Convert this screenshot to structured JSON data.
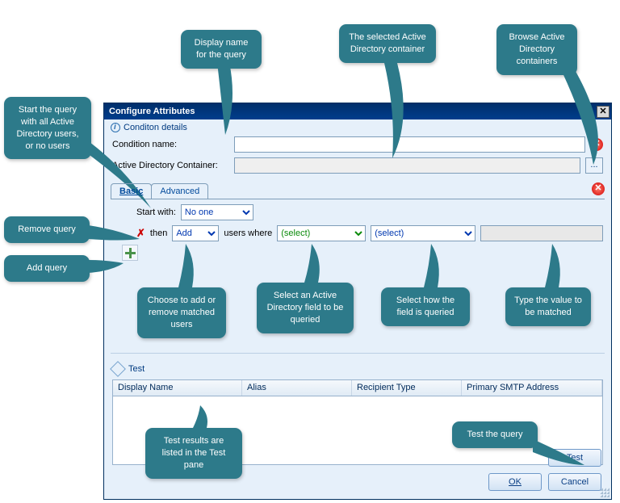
{
  "title": "Configure Attributes",
  "section_details": "Conditon details",
  "labels": {
    "condition_name": "Condition name:",
    "ad_container": "Active Directory Container:"
  },
  "inputs": {
    "condition_name_value": "",
    "ad_container_value": ""
  },
  "browse_btn_text": "...",
  "tabs": {
    "basic": "Basic",
    "advanced": "Advanced"
  },
  "query": {
    "start_with_label": "Start with:",
    "start_with_value": "No one",
    "then_label": "then",
    "action": "Add",
    "users_where": "users where",
    "field_select": "(select)",
    "op_select": "(select)",
    "value_input": ""
  },
  "test_label": "Test",
  "grid_headers": [
    "Display Name",
    "Alias",
    "Recipient Type",
    "Primary SMTP Address"
  ],
  "buttons": {
    "test": "Test",
    "ok": "OK",
    "cancel": "Cancel"
  },
  "callouts": {
    "display_name": "Display name for the query",
    "ad_container": "The selected Active Directory container",
    "browse": "Browse Active Directory containers",
    "start_with": "Start the query with all Active Directory users, or no users",
    "remove": "Remove query",
    "add": "Add query",
    "choose": "Choose to add or remove matched users",
    "field": "Select an Active Directory field to be queried",
    "op": "Select how the field is queried",
    "value": "Type the value to be matched",
    "results": "Test results are listed in the Test pane",
    "testq": "Test the query"
  }
}
